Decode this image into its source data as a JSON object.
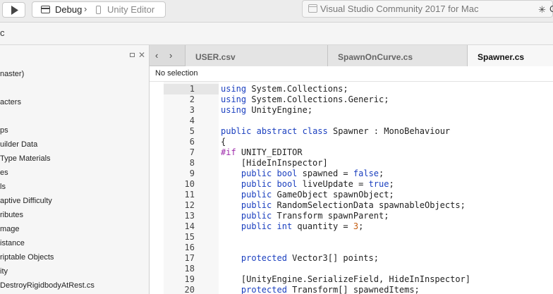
{
  "toolbar": {
    "configuration": "Debug",
    "separator": "›",
    "target": "Unity Editor",
    "app_title": "Visual Studio Community 2017 for Mac",
    "status_stub": "C"
  },
  "search": {
    "stub": "c"
  },
  "solution_tree": {
    "items": [
      {
        "label": "naster)"
      },
      {
        "label": "acters"
      },
      {
        "label": "ps"
      },
      {
        "label": "uilder Data"
      },
      {
        "label": "Type Materials"
      },
      {
        "label": "es"
      },
      {
        "label": "ls"
      },
      {
        "label": "aptive Difficulty"
      },
      {
        "label": "ributes"
      },
      {
        "label": "mage"
      },
      {
        "label": "istance"
      },
      {
        "label": "riptable Objects"
      },
      {
        "label": "ity"
      },
      {
        "label": "DestroyRigidbodyAtRest.cs"
      }
    ]
  },
  "tabs": [
    {
      "label": "USER.csv"
    },
    {
      "label": "SpawnOnCurve.cs"
    },
    {
      "label": "Spawner.cs"
    }
  ],
  "breadcrumb": "No selection",
  "editor": {
    "lines": [
      {
        "num": "1",
        "text": "using System.Collections;"
      },
      {
        "num": "2",
        "text": "using System.Collections.Generic;"
      },
      {
        "num": "3",
        "text": "using UnityEngine;"
      },
      {
        "num": "4",
        "text": ""
      },
      {
        "num": "5",
        "text": "public abstract class Spawner : MonoBehaviour"
      },
      {
        "num": "6",
        "text": "{"
      },
      {
        "num": "7",
        "text": "#if UNITY_EDITOR"
      },
      {
        "num": "8",
        "text": "    [HideInInspector]"
      },
      {
        "num": "9",
        "text": "    public bool spawned = false;"
      },
      {
        "num": "10",
        "text": "    public bool liveUpdate = true;"
      },
      {
        "num": "11",
        "text": "    public GameObject spawnObject;"
      },
      {
        "num": "12",
        "text": "    public RandomSelectionData spawnableObjects;"
      },
      {
        "num": "13",
        "text": "    public Transform spawnParent;"
      },
      {
        "num": "14",
        "text": "    public int quantity = 3;"
      },
      {
        "num": "15",
        "text": ""
      },
      {
        "num": "16",
        "text": ""
      },
      {
        "num": "17",
        "text": "    protected Vector3[] points;"
      },
      {
        "num": "18",
        "text": ""
      },
      {
        "num": "19",
        "text": "    [UnityEngine.SerializeField, HideInInspector]"
      },
      {
        "num": "20",
        "text": "    protected Transform[] spawnedItems;"
      }
    ]
  }
}
